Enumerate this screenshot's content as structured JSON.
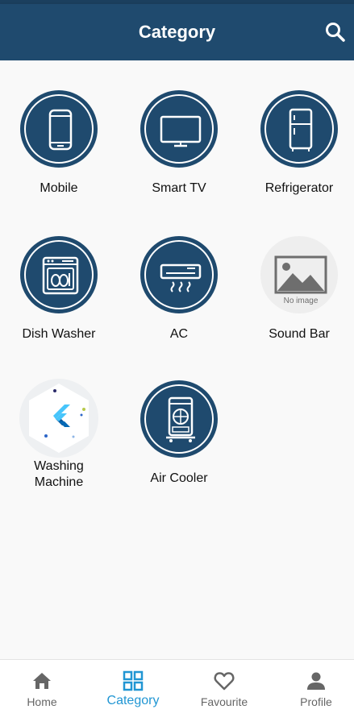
{
  "colors": {
    "primary": "#1f4a6e",
    "active_tab": "#2196d3",
    "inactive_tab": "#666666"
  },
  "appbar": {
    "title": "Category",
    "search_icon": "search-icon"
  },
  "categories": [
    {
      "label": "Mobile",
      "icon": "mobile-phone-icon"
    },
    {
      "label": "Smart TV",
      "icon": "tv-icon"
    },
    {
      "label": "Refrigerator",
      "icon": "refrigerator-icon"
    },
    {
      "label": "Dish Washer",
      "icon": "dishwasher-icon"
    },
    {
      "label": "AC",
      "icon": "air-conditioner-icon"
    },
    {
      "label": "Sound Bar",
      "icon": "placeholder-image-icon",
      "placeholder_text": "No image"
    },
    {
      "label": "Washing\nMachine",
      "icon": "flutter-logo-icon"
    },
    {
      "label": "Air Cooler",
      "icon": "air-cooler-icon"
    }
  ],
  "bottom_nav": {
    "active": "Category",
    "items": [
      {
        "label": "Home",
        "icon": "home-icon"
      },
      {
        "label": "Category",
        "icon": "grid-icon"
      },
      {
        "label": "Favourite",
        "icon": "heart-icon"
      },
      {
        "label": "Profile",
        "icon": "person-icon"
      }
    ]
  }
}
